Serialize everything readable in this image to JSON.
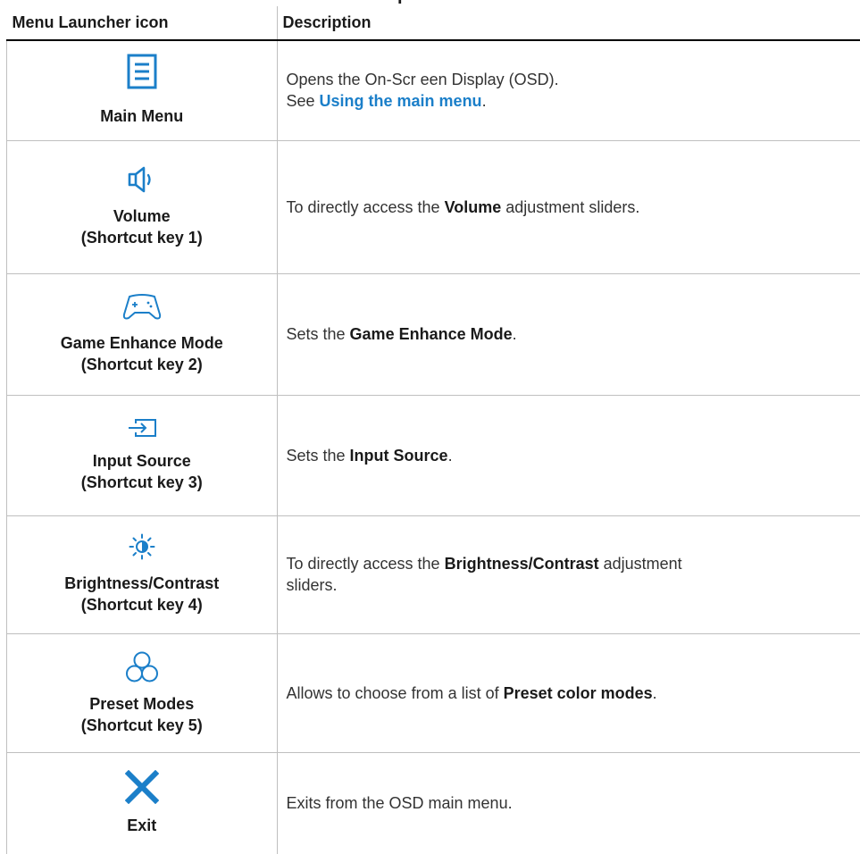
{
  "page_title_fragment": "p",
  "colors": {
    "accent": "#1b7fc9",
    "text": "#1a1a1a",
    "rule": "#bfbfbf"
  },
  "table": {
    "headers": {
      "icon": "Menu Launcher icon",
      "description": "Description"
    },
    "rows": [
      {
        "icon": "main-menu-icon",
        "label_line1": "Main Menu",
        "label_line2": "",
        "desc_line1": "Opens the On-Scr een Display (OSD).",
        "desc_see": "See ",
        "desc_link": "Using the main menu",
        "desc_after_link": "."
      },
      {
        "icon": "volume-icon",
        "label_line1": "Volume",
        "label_line2": "(Shortcut key 1)",
        "desc_before": "To directly access the ",
        "desc_bold": "Volume",
        "desc_after": " adjustment sliders."
      },
      {
        "icon": "game-controller-icon",
        "label_line1": "Game Enhance Mode",
        "label_line2": "(Shortcut key 2)",
        "desc_before": "Sets the ",
        "desc_bold": "Game Enhance Mode",
        "desc_after": "."
      },
      {
        "icon": "input-source-icon",
        "label_line1": "Input Source",
        "label_line2": "(Shortcut key 3)",
        "desc_before": "Sets the ",
        "desc_bold": "Input Source",
        "desc_after": "."
      },
      {
        "icon": "brightness-contrast-icon",
        "label_line1": "Brightness/Contrast",
        "label_line2": "(Shortcut key 4)",
        "desc_before": "To directly access the ",
        "desc_bold": "Brightness/Contrast",
        "desc_after": " adjustment",
        "desc_line2": "sliders."
      },
      {
        "icon": "preset-modes-icon",
        "label_line1": "Preset Modes",
        "label_line2": "(Shortcut key 5)",
        "desc_before": "Allows to choose from a list of ",
        "desc_bold": "Preset color modes",
        "desc_after": "."
      },
      {
        "icon": "exit-icon",
        "label_line1": "Exit",
        "label_line2": "",
        "desc_before": "Exits from the OSD main menu.",
        "desc_bold": "",
        "desc_after": ""
      }
    ]
  }
}
